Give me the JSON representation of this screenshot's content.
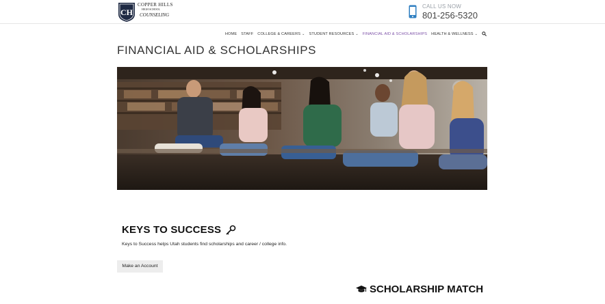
{
  "header": {
    "school_name": "COPPER HILLS",
    "school_sub": "HIGH SCHOOL",
    "department": "COUNSELING",
    "call_label": "CALL US NOW",
    "phone": "801-256-5320"
  },
  "nav": [
    {
      "label": "HOME",
      "dropdown": false,
      "active": false
    },
    {
      "label": "STAFF",
      "dropdown": false,
      "active": false
    },
    {
      "label": "COLLEGE & CAREERS",
      "dropdown": true,
      "active": false
    },
    {
      "label": "STUDENT RESOURCES",
      "dropdown": true,
      "active": false
    },
    {
      "label": "FINANCIAL AID & SCHOLARSHIPS",
      "dropdown": false,
      "active": true
    },
    {
      "label": "HEALTH & WELLNESS",
      "dropdown": true,
      "active": false
    }
  ],
  "page": {
    "title": "FINANCIAL AID & SCHOLARSHIPS"
  },
  "keys_section": {
    "title": "KEYS TO SUCCESS",
    "description": "Keys to Success helps Utah students find scholarships and career / college info.",
    "button": "Make an Account"
  },
  "scholarship_section": {
    "title": "SCHOLARSHIP MATCH"
  },
  "colors": {
    "accent": "#7b4fa6",
    "phone_icon": "#2f7fc1",
    "crest": "#1f2a44"
  },
  "icons": {
    "phone": "phone-icon",
    "search": "search-icon",
    "key": "key-icon",
    "graduation": "graduation-cap-icon",
    "chevron": "chevron-down-icon"
  }
}
